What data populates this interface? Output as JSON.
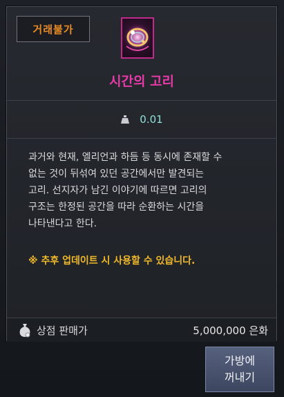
{
  "tooltip": {
    "trade_badge": "거래불가",
    "item_icon": "ring-of-time-icon",
    "item_name": "시간의 고리",
    "weight_icon": "weight-icon",
    "weight": "0.01",
    "description": "과거와 현재, 엘리언과 하듬 등 동시에 존재할 수\n없는 것이 뒤섞여 있던 공간에서만 발견되는\n고리. 선지자가 남긴 이야기에 따르면 고리의\n구조는 한정된 공간을 따라 순환하는 시간을\n나타낸다고 한다.",
    "notice": "※ 추후 업데이트 시 사용할 수 있습니다.",
    "price_icon": "money-bag-icon",
    "price_label": "상점 판매가",
    "price_value": "5,000,000 은화"
  },
  "actions": {
    "take_out_line1": "가방에",
    "take_out_line2": "꺼내기"
  },
  "colors": {
    "item_name": "#e63aa8",
    "trade_badge": "#e88a22",
    "weight": "#8fe0d6",
    "notice": "#f0b92a"
  }
}
